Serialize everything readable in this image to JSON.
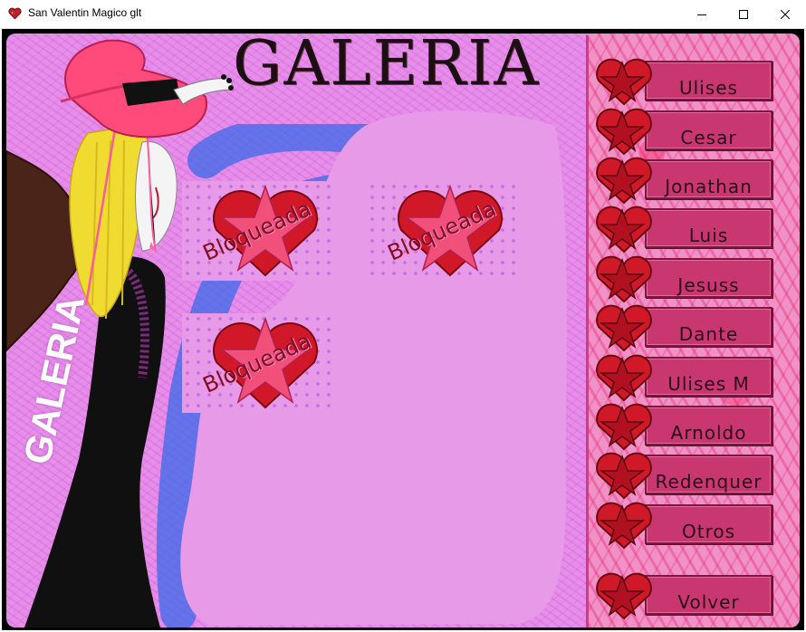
{
  "window": {
    "title": "San Valentin Magico glt",
    "icon": "heart-icon",
    "controls": [
      "minimize-icon",
      "maximize-icon",
      "close-icon"
    ]
  },
  "gallery": {
    "title": "GALERIA",
    "side_label": "GALERIA",
    "slots": [
      {
        "label": "Bloqueada"
      },
      {
        "label": "Bloqueada"
      },
      {
        "label": "Bloqueada"
      }
    ]
  },
  "menu": {
    "buttons": [
      {
        "label": "Ulises"
      },
      {
        "label": "Cesar"
      },
      {
        "label": "Jonathan"
      },
      {
        "label": "Luis"
      },
      {
        "label": "Jesuss"
      },
      {
        "label": "Dante"
      },
      {
        "label": "Ulises M"
      },
      {
        "label": "Arnoldo"
      },
      {
        "label": "Redenquer"
      },
      {
        "label": "Otros"
      }
    ],
    "back_label": "Volver"
  },
  "colors": {
    "background": "#e88ee8",
    "button": "#c8376f",
    "heart": "#d01828",
    "star": "#f0507a"
  }
}
